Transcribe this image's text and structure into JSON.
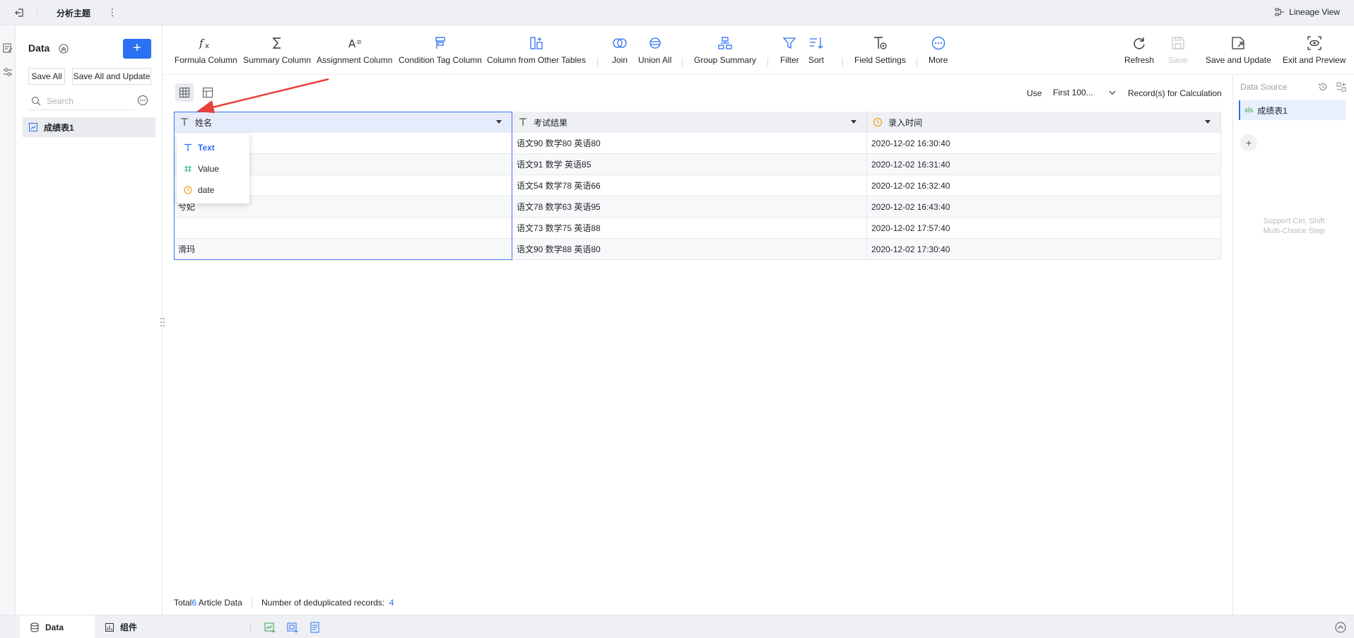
{
  "topbar": {
    "title": "分析主题",
    "kebab": "⋮",
    "lineage_label": "Lineage View"
  },
  "left_panel": {
    "title": "Data",
    "add_label": "+",
    "save_all": "Save All",
    "save_all_update": "Save All and Update",
    "search_placeholder": "Search",
    "items": [
      {
        "label": "成绩表1"
      }
    ]
  },
  "toolbar": {
    "formula": "Formula Column",
    "summary": "Summary Column",
    "assignment": "Assignment Column",
    "condition_tag": "Condition Tag Column",
    "other_tables": "Column from Other Tables",
    "join": "Join",
    "union_all": "Union All",
    "group_summary": "Group Summary",
    "filter": "Filter",
    "sort": "Sort",
    "field_settings": "Field Settings",
    "more": "More",
    "refresh": "Refresh",
    "save": "Save",
    "save_update": "Save and Update",
    "exit_preview": "Exit and Preview"
  },
  "calc": {
    "use": "Use",
    "select_value": "First 100...",
    "records": "Record(s) for Calculation"
  },
  "table": {
    "columns": [
      {
        "name": "姓名",
        "type_icon": "text-type-icon"
      },
      {
        "name": "考试结果",
        "type_icon": "text-type-icon"
      },
      {
        "name": "录入时间",
        "type_icon": "date-type-icon"
      }
    ],
    "rows": [
      [
        "",
        "语文90 数学80 英语80",
        "2020-12-02 16:30:40"
      ],
      [
        "",
        "语文91 数学 英语85",
        "2020-12-02 16:31:40"
      ],
      [
        "",
        "语文54 数学78 英语66",
        "2020-12-02 16:32:40"
      ],
      [
        "兮妃",
        "语文78 数学63 英语95",
        "2020-12-02 16:43:40"
      ],
      [
        "",
        "语文73 数学75 英语88",
        "2020-12-02 17:57:40"
      ],
      [
        "滑玛",
        "语文90 数学88 英语80",
        "2020-12-02 17:30:40"
      ]
    ]
  },
  "type_dropdown": {
    "options": [
      {
        "label": "Text",
        "icon": "T",
        "active": true
      },
      {
        "label": "Value",
        "icon": "#",
        "active": false
      },
      {
        "label": "date",
        "icon": "◷",
        "active": false
      }
    ]
  },
  "status": {
    "total_prefix": "Total",
    "total_count": "6",
    "total_suffix": "Article Data",
    "dedup_label": "Number of deduplicated records:",
    "dedup_count": "4"
  },
  "right_panel": {
    "title": "Data Source",
    "item": "成绩表1",
    "item_badge": "xls",
    "hint_line1": "Support Ctrl, Shift",
    "hint_line2": "Multi-Choice Step"
  },
  "bottom": {
    "tab_data": "Data",
    "tab_component": "组件"
  },
  "colors": {
    "accent": "#2b6ff3",
    "arrow": "#e8413a",
    "date_icon": "#f0a020",
    "value_icon": "#2fb3a0"
  }
}
